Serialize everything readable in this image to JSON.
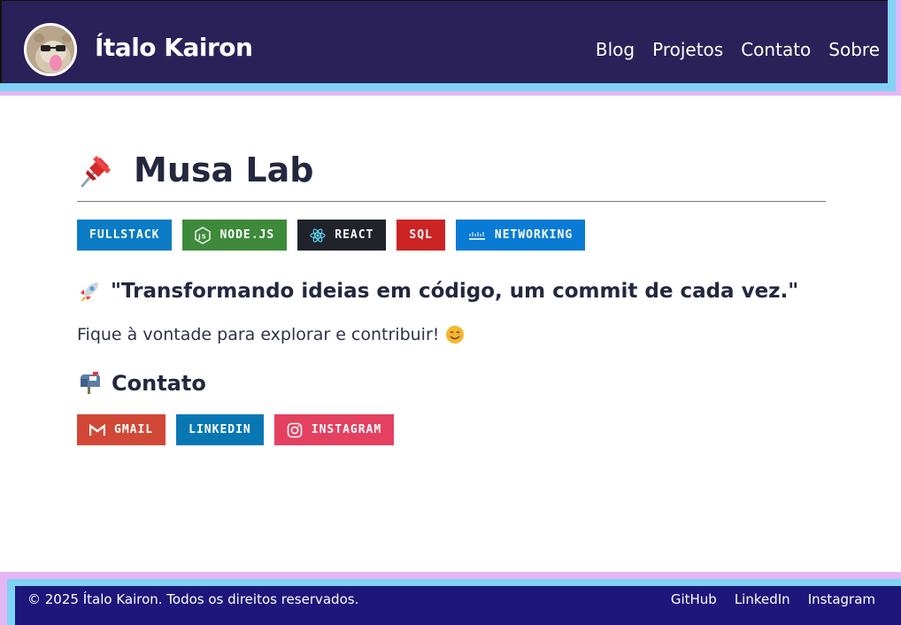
{
  "header": {
    "brand": "Ítalo Kairon",
    "nav": [
      "Blog",
      "Projetos",
      "Contato",
      "Sobre"
    ]
  },
  "main": {
    "title": "Musa Lab",
    "title_icon": "pushpin-icon",
    "badges": [
      {
        "label": "FULLSTACK",
        "color": "#0a7bc4",
        "icon": ""
      },
      {
        "label": "NODE.JS",
        "color": "#3d8a3a",
        "icon": "nodejs-icon"
      },
      {
        "label": "REACT",
        "color": "#20232a",
        "icon": "react-icon"
      },
      {
        "label": "SQL",
        "color": "#cc2424",
        "icon": ""
      },
      {
        "label": "NETWORKING",
        "color": "#0a7bd4",
        "icon": "cisco-icon"
      }
    ],
    "quote": "\"Transformando ideias em código, um commit de cada vez.\"",
    "quote_icon": "rocket-icon",
    "explore": "Fique à vontade para explorar e contribuir!",
    "explore_icon": "smile-emoji-icon",
    "contact_title": "Contato",
    "contact_icon": "mailbox-icon",
    "contact_badges": [
      {
        "label": "GMAIL",
        "color": "#d14836",
        "icon": "gmail-icon"
      },
      {
        "label": "LINKEDIN",
        "color": "#0a77b5",
        "icon": ""
      },
      {
        "label": "INSTAGRAM",
        "color": "#e4405f",
        "icon": "instagram-icon"
      }
    ]
  },
  "footer": {
    "copyright": "© 2025 Ítalo Kairon. Todos os direitos reservados.",
    "links": [
      "GitHub",
      "LinkedIn",
      "Instagram"
    ]
  }
}
